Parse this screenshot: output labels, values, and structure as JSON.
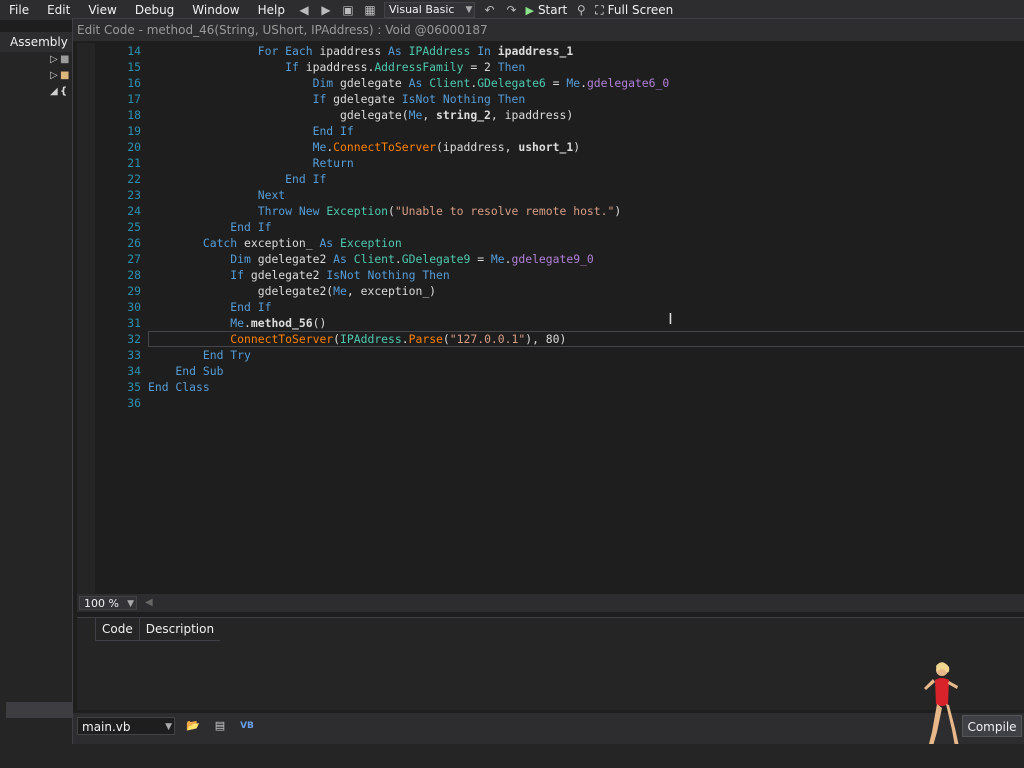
{
  "menu": {
    "items": [
      "File",
      "Edit",
      "View",
      "Debug",
      "Window",
      "Help"
    ]
  },
  "toolbar": {
    "language": "Visual Basic",
    "start_label": "Start",
    "fullscreen_label": "Full Screen"
  },
  "assembly_panel": {
    "tab_label": "Assembly Explorer"
  },
  "dialog": {
    "title": "Edit Code - method_46(String, UShort, IPAddress) : Void @06000187"
  },
  "editor": {
    "current_line": "32",
    "lines": [
      {
        "n": "14",
        "code": [
          {
            "c": "kw",
            "t": "                For Each "
          },
          {
            "c": "plain",
            "t": "ipaddress "
          },
          {
            "c": "kw",
            "t": "As "
          },
          {
            "c": "ty",
            "t": "IPAddress "
          },
          {
            "c": "kw",
            "t": "In "
          },
          {
            "c": "bold",
            "t": "ipaddress_1"
          }
        ]
      },
      {
        "n": "15",
        "code": [
          {
            "c": "kw",
            "t": "                    If "
          },
          {
            "c": "plain",
            "t": "ipaddress."
          },
          {
            "c": "prop",
            "t": "AddressFamily"
          },
          {
            "c": "plain",
            "t": " = 2 "
          },
          {
            "c": "kw",
            "t": "Then"
          }
        ]
      },
      {
        "n": "16",
        "code": [
          {
            "c": "kw",
            "t": "                        Dim "
          },
          {
            "c": "plain",
            "t": "gdelegate "
          },
          {
            "c": "kw",
            "t": "As "
          },
          {
            "c": "ty",
            "t": "Client"
          },
          {
            "c": "plain",
            "t": "."
          },
          {
            "c": "ty",
            "t": "GDelegate6"
          },
          {
            "c": "plain",
            "t": " = "
          },
          {
            "c": "kw",
            "t": "Me"
          },
          {
            "c": "plain",
            "t": "."
          },
          {
            "c": "fld",
            "t": "gdelegate6_0"
          }
        ]
      },
      {
        "n": "17",
        "code": [
          {
            "c": "kw",
            "t": "                        If "
          },
          {
            "c": "plain",
            "t": "gdelegate "
          },
          {
            "c": "kw",
            "t": "IsNot Nothing Then"
          }
        ]
      },
      {
        "n": "18",
        "code": [
          {
            "c": "plain",
            "t": "                            gdelegate("
          },
          {
            "c": "kw",
            "t": "Me"
          },
          {
            "c": "plain",
            "t": ", "
          },
          {
            "c": "bold",
            "t": "string_2"
          },
          {
            "c": "plain",
            "t": ", ipaddress)"
          }
        ]
      },
      {
        "n": "19",
        "code": [
          {
            "c": "kw",
            "t": "                        End If"
          }
        ]
      },
      {
        "n": "20",
        "code": [
          {
            "c": "kw",
            "t": "                        Me"
          },
          {
            "c": "plain",
            "t": "."
          },
          {
            "c": "meth",
            "t": "ConnectToServer"
          },
          {
            "c": "plain",
            "t": "(ipaddress, "
          },
          {
            "c": "bold",
            "t": "ushort_1"
          },
          {
            "c": "plain",
            "t": ")"
          }
        ]
      },
      {
        "n": "21",
        "code": [
          {
            "c": "kw",
            "t": "                        Return"
          }
        ]
      },
      {
        "n": "22",
        "code": [
          {
            "c": "kw",
            "t": "                    End If"
          }
        ]
      },
      {
        "n": "23",
        "code": [
          {
            "c": "kw",
            "t": "                Next"
          }
        ]
      },
      {
        "n": "24",
        "code": [
          {
            "c": "kw",
            "t": "                Throw New "
          },
          {
            "c": "ty",
            "t": "Exception"
          },
          {
            "c": "plain",
            "t": "("
          },
          {
            "c": "str",
            "t": "\"Unable to resolve remote host.\""
          },
          {
            "c": "plain",
            "t": ")"
          }
        ]
      },
      {
        "n": "25",
        "code": [
          {
            "c": "kw",
            "t": "            End If"
          }
        ]
      },
      {
        "n": "26",
        "code": [
          {
            "c": "kw",
            "t": "        Catch "
          },
          {
            "c": "plain",
            "t": "exception_ "
          },
          {
            "c": "kw",
            "t": "As "
          },
          {
            "c": "ty",
            "t": "Exception"
          }
        ]
      },
      {
        "n": "27",
        "code": [
          {
            "c": "kw",
            "t": "            Dim "
          },
          {
            "c": "plain",
            "t": "gdelegate2 "
          },
          {
            "c": "kw",
            "t": "As "
          },
          {
            "c": "ty",
            "t": "Client"
          },
          {
            "c": "plain",
            "t": "."
          },
          {
            "c": "ty",
            "t": "GDelegate9"
          },
          {
            "c": "plain",
            "t": " = "
          },
          {
            "c": "kw",
            "t": "Me"
          },
          {
            "c": "plain",
            "t": "."
          },
          {
            "c": "fld",
            "t": "gdelegate9_0"
          }
        ]
      },
      {
        "n": "28",
        "code": [
          {
            "c": "kw",
            "t": "            If "
          },
          {
            "c": "plain",
            "t": "gdelegate2 "
          },
          {
            "c": "kw",
            "t": "IsNot Nothing Then"
          }
        ]
      },
      {
        "n": "29",
        "code": [
          {
            "c": "plain",
            "t": "                gdelegate2("
          },
          {
            "c": "kw",
            "t": "Me"
          },
          {
            "c": "plain",
            "t": ", exception_)"
          }
        ]
      },
      {
        "n": "30",
        "code": [
          {
            "c": "kw",
            "t": "            End If"
          }
        ]
      },
      {
        "n": "31",
        "code": [
          {
            "c": "kw",
            "t": "            Me"
          },
          {
            "c": "plain",
            "t": "."
          },
          {
            "c": "bold",
            "t": "method_56"
          },
          {
            "c": "plain",
            "t": "()"
          }
        ]
      },
      {
        "n": "32",
        "code": [
          {
            "c": "meth",
            "t": "            ConnectToServer"
          },
          {
            "c": "plain",
            "t": "("
          },
          {
            "c": "ty",
            "t": "IPAddress"
          },
          {
            "c": "plain",
            "t": "."
          },
          {
            "c": "meth",
            "t": "Parse"
          },
          {
            "c": "plain",
            "t": "("
          },
          {
            "c": "str",
            "t": "\"127.0.0.1\""
          },
          {
            "c": "plain",
            "t": "), 80)"
          }
        ]
      },
      {
        "n": "33",
        "code": [
          {
            "c": "kw",
            "t": "        End Try"
          }
        ]
      },
      {
        "n": "34",
        "code": [
          {
            "c": "kw",
            "t": "    End Sub"
          }
        ]
      },
      {
        "n": "35",
        "code": [
          {
            "c": "kw",
            "t": "End Class"
          }
        ]
      },
      {
        "n": "36",
        "code": []
      }
    ]
  },
  "zoom": {
    "value": "100 %"
  },
  "error_list": {
    "columns": [
      "Code",
      "Description"
    ]
  },
  "bottom": {
    "file": "main.vb",
    "compile_label": "Compile"
  }
}
